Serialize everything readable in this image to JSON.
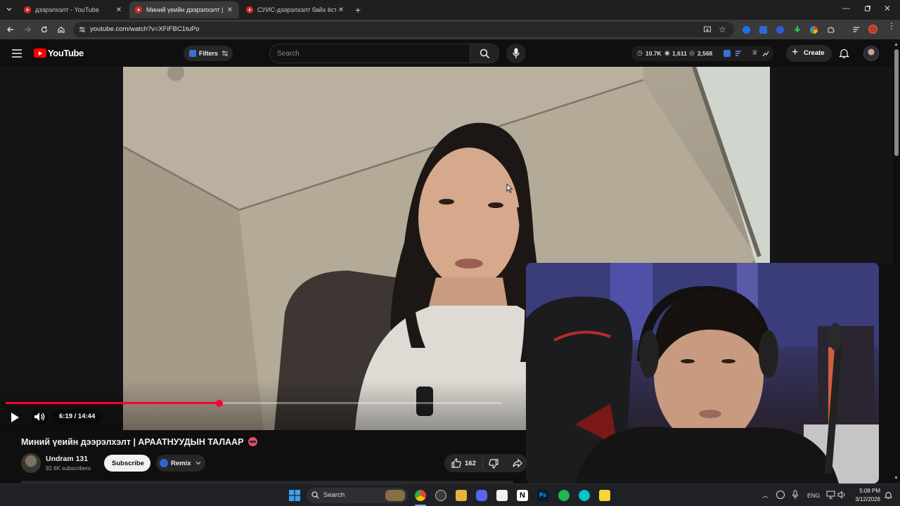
{
  "browser": {
    "tabs": [
      {
        "title": "дээрэлхэлт - YouTube",
        "active": false
      },
      {
        "title": "Миний үеийн дээрэлхэлт | АРА",
        "active": true
      },
      {
        "title": "СУИС-дээрэлхэлт байх ёстой ю",
        "active": false
      }
    ],
    "url": "youtube.com/watch?v=XFiFBC1tuPo"
  },
  "youtube": {
    "logo_text": "YouTube",
    "filters_label": "Filters",
    "search_placeholder": "Search",
    "stats": {
      "views_a": "10.7K",
      "views_b": "1,611",
      "views_c": "2,568"
    },
    "create_label": "Create"
  },
  "player": {
    "time": "6:19 / 14:44",
    "progress": 0.43
  },
  "video": {
    "title": "Миний үеийн дээрэлхэлт | АРААТНУУДЫН ТАЛААР",
    "channel_name": "Undram 131",
    "subscribers": "92.6K subscribers",
    "subscribe_label": "Subscribe",
    "remix_label": "Remix",
    "likes": "162"
  },
  "taskbar": {
    "search_label": "Search",
    "lang": "ENG",
    "time": "5:08 PM",
    "date": "3/12/2026"
  },
  "colors": {
    "accent": "#ff0033",
    "yt_red": "#ff0000"
  }
}
